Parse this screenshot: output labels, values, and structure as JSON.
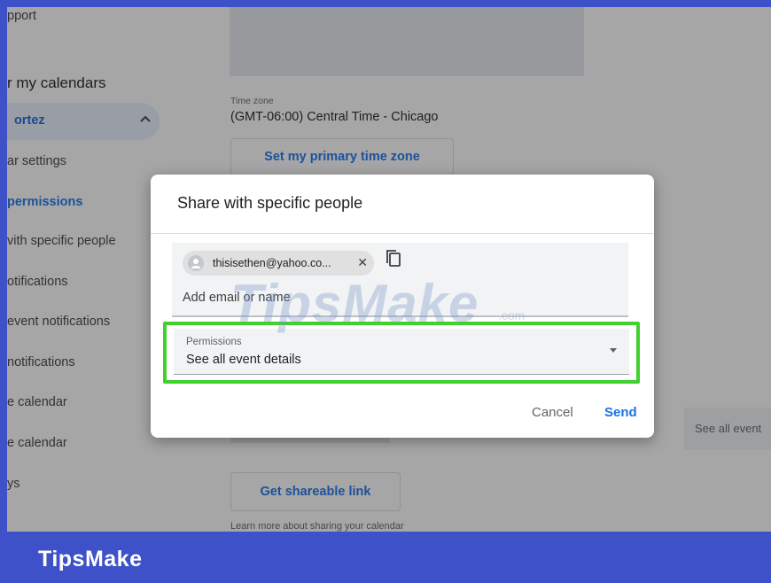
{
  "sidebar": {
    "items": [
      {
        "label": "pport",
        "active": false
      },
      {
        "label": "r my calendars",
        "active": false
      },
      {
        "label": "ortez",
        "active": false
      },
      {
        "label": "ar settings",
        "active": false
      },
      {
        "label": "permissions",
        "active": true
      },
      {
        "label": "vith specific people",
        "active": false
      },
      {
        "label": "otifications",
        "active": false
      },
      {
        "label": "event notifications",
        "active": false
      },
      {
        "label": "notifications",
        "active": false
      },
      {
        "label": "e calendar",
        "active": false
      },
      {
        "label": "e calendar",
        "active": false
      },
      {
        "label": "ys",
        "active": false
      }
    ]
  },
  "settings": {
    "time_zone_label": "Time zone",
    "time_zone_value": "(GMT-06:00) Central Time - Chicago",
    "set_primary_tz_label": "Set my primary time zone",
    "see_all_event_label": "See all event",
    "shareable_link_label": "Get shareable link",
    "learn_more_text": "Learn more about sharing your calendar"
  },
  "dialog": {
    "title": "Share with specific people",
    "email_chip": "thisisethen@yahoo.co...",
    "chip_close": "✕",
    "add_email_placeholder": "Add email or name",
    "permissions_label": "Permissions",
    "permissions_value": "See all event details",
    "cancel_label": "Cancel",
    "send_label": "Send"
  },
  "watermark": {
    "text": "TipsMake",
    "small": ".com"
  },
  "branding": {
    "label": "TipsMake"
  },
  "colors": {
    "frame": "#3f51c9",
    "accent": "#1a73e8",
    "highlight": "#40d12e"
  },
  "icons": [
    "chevron-up-icon",
    "person-icon",
    "close-icon",
    "copy-icon",
    "dropdown-arrow-icon"
  ]
}
